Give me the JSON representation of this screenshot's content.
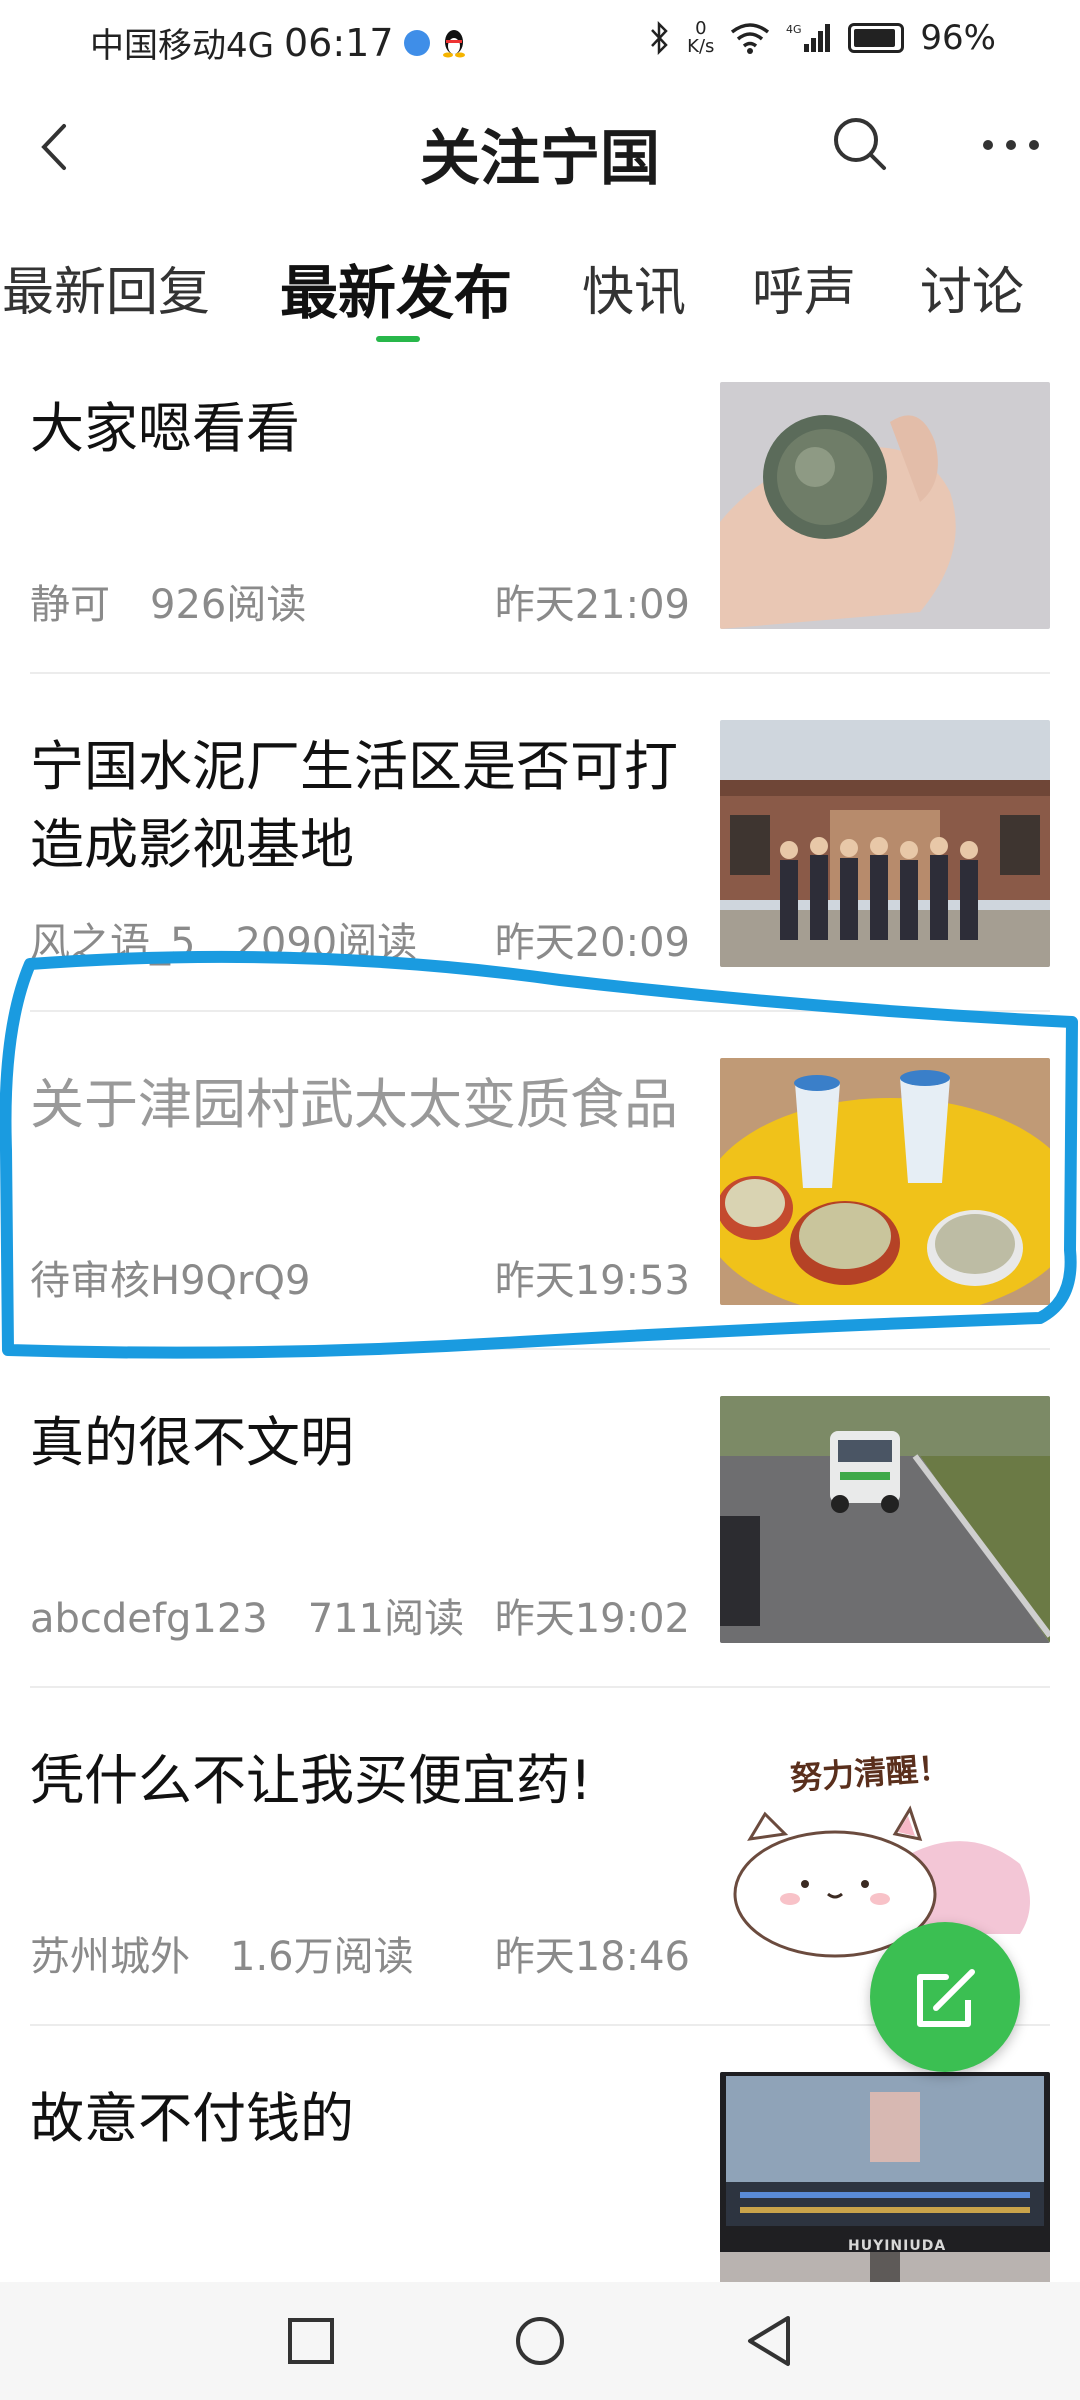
{
  "status_bar": {
    "carrier": "中国移动4G",
    "time": "06:17",
    "net_speed_value": "0",
    "net_speed_unit": "K/s",
    "battery": "96%"
  },
  "header": {
    "title": "关注宁国"
  },
  "tabs": [
    {
      "label": "最新回复",
      "active": false
    },
    {
      "label": "最新发布",
      "active": true
    },
    {
      "label": "快讯",
      "active": false
    },
    {
      "label": "呼声",
      "active": false
    },
    {
      "label": "讨论",
      "active": false
    }
  ],
  "feed": [
    {
      "title": "大家嗯看看",
      "author": "静可",
      "reads": "926阅读",
      "time": "昨天21:09"
    },
    {
      "title": "宁国水泥厂生活区是否可打造成影视基地",
      "author": "风之语_5",
      "reads": "2090阅读",
      "time": "昨天20:09"
    },
    {
      "title": "关于津园村武太太变质食品",
      "author": "待审核H9QrQ9",
      "reads": "",
      "time": "昨天19:53"
    },
    {
      "title": "真的很不文明",
      "author": "abcdefg123",
      "reads": "711阅读",
      "time": "昨天19:02"
    },
    {
      "title": "凭什么不让我买便宜药!",
      "author": "苏州城外",
      "reads": "1.6万阅读",
      "time": "昨天18:46"
    },
    {
      "title": "故意不付钱的",
      "author": "",
      "reads": "",
      "time": ""
    }
  ],
  "thumb_texts": {
    "sticker_caption": "努力清醒！",
    "monitor_brand": "HUYINIUDA"
  },
  "colors": {
    "accent": "#28b74a",
    "fab": "#3bbf52",
    "highlight": "#1a9be0"
  }
}
